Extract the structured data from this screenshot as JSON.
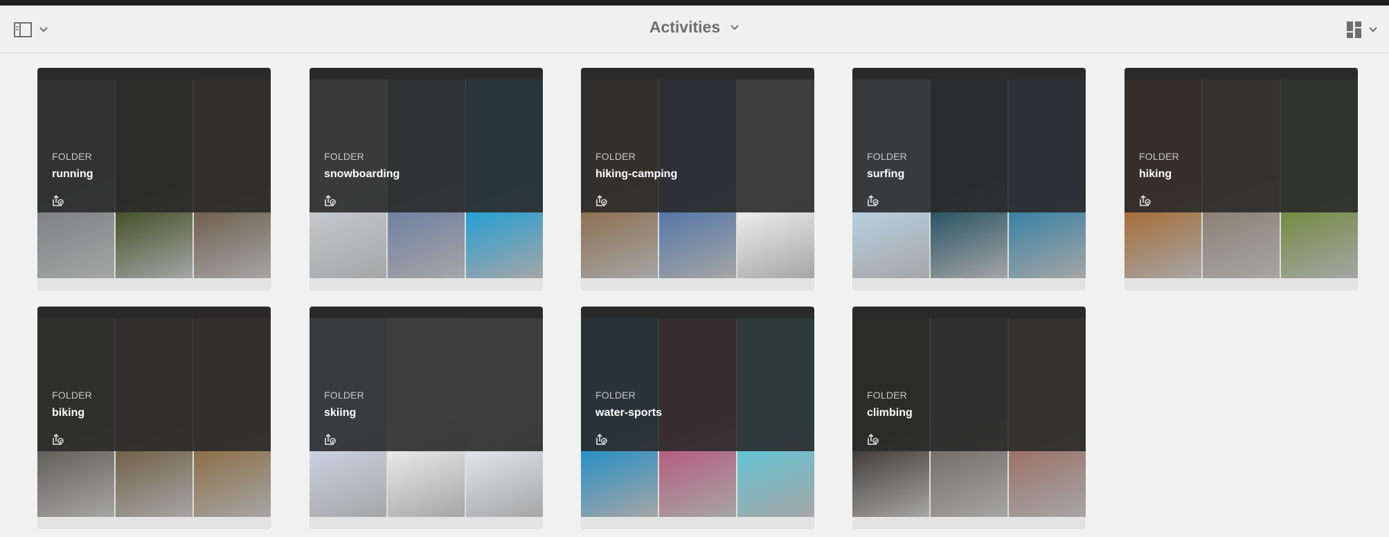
{
  "toolbar": {
    "title": "Activities",
    "rail_toggle_icon": "rail-toggle-icon",
    "view_icon": "card-view-icon"
  },
  "cards": [
    {
      "type_label": "FOLDER",
      "name": "running",
      "thumbs": [
        "#7c7f80",
        "#3d4a1f",
        "#6b5a48"
      ]
    },
    {
      "type_label": "FOLDER",
      "name": "snowboarding",
      "thumbs": [
        "#c7cbd0",
        "#6c7ea2",
        "#1a9fd8"
      ]
    },
    {
      "type_label": "FOLDER",
      "name": "hiking-camping",
      "thumbs": [
        "#8c6c4c",
        "#4e73a8",
        "#f2f2f2"
      ]
    },
    {
      "type_label": "FOLDER",
      "name": "surfing",
      "thumbs": [
        "#b9d3e6",
        "#1e4e5e",
        "#2f7fa4"
      ]
    },
    {
      "type_label": "FOLDER",
      "name": "hiking",
      "thumbs": [
        "#a76a2f",
        "#8a7f70",
        "#6e8a3a"
      ]
    },
    {
      "type_label": "FOLDER",
      "name": "biking",
      "thumbs": [
        "#5d5a52",
        "#6d5c40",
        "#8a6b3f"
      ]
    },
    {
      "type_label": "FOLDER",
      "name": "skiing",
      "thumbs": [
        "#ccd6e6",
        "#eeeeee",
        "#e8eaf0"
      ]
    },
    {
      "type_label": "FOLDER",
      "name": "water-sports",
      "thumbs": [
        "#1d8ec8",
        "#b7587a",
        "#5ec7d8"
      ]
    },
    {
      "type_label": "FOLDER",
      "name": "climbing",
      "thumbs": [
        "#3b3530",
        "#6e6a66",
        "#9b6e64"
      ]
    }
  ],
  "publish_icon": "publish-status-icon"
}
